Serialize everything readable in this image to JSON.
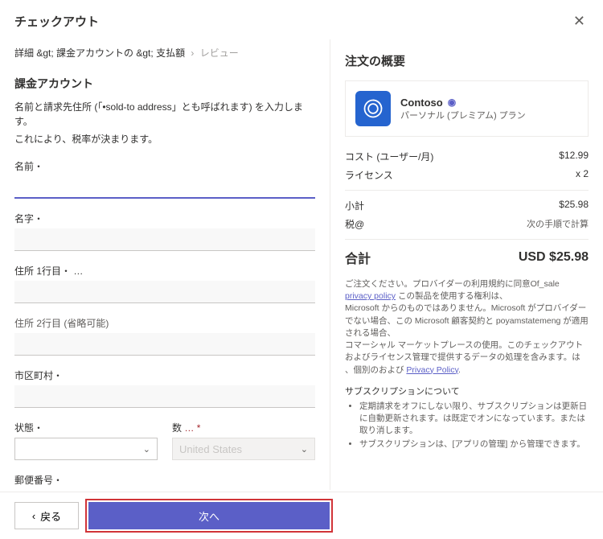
{
  "header": {
    "title": "チェックアウト"
  },
  "breadcrumb": {
    "step1": "詳細 &gt;",
    "step2": "課金アカウントの &gt;",
    "step3": "支払額",
    "step4": "レビュー"
  },
  "form": {
    "section_title": "課金アカウント",
    "help1": "名前と請求先住所 (「•sold-to address」とも呼ばれます) を入力します。",
    "help2": "これにより、税率が決まります。",
    "labels": {
      "first_name": "名前",
      "last_name": "名字",
      "address1": "住所 1行目",
      "address2": "住所 2行目 (省略可能)",
      "city": "市区町村",
      "state": "状態",
      "country": "数",
      "postal": "郵便番号"
    },
    "country_placeholder": "United States"
  },
  "footer": {
    "back": "戻る",
    "next": "次へ"
  },
  "summary": {
    "title": "注文の概要",
    "product_name": "Contoso",
    "product_sub": "パーソナル (プレミアム) プラン",
    "cost_label": "コスト (ユーザー/月)",
    "cost_value": "$12.99",
    "license_label": "ライセンス",
    "license_value": "x 2",
    "subtotal_label": "小計",
    "subtotal_value": "$25.98",
    "tax_label": "税@",
    "tax_value": "次の手順で計算",
    "total_label": "合計",
    "total_value": "USD $25.98"
  },
  "legal": {
    "line1": "ご注文ください。プロバイダーの利用規約に同意Of_sale",
    "link1": "privacy policy",
    "line1b": " この製品を使用する権利は、",
    "line2": "Microsoft からのものではありません。Microsoft がプロバイダーでない場合、この Microsoft 顧客契約と poyamstatemeng が適用される場合、",
    "line3": "コマーシャル マーケットプレースの使用。このチェックアウト",
    "line4": "およびライセンス管理で提供するデータの処理を含みます。は",
    "line5a": "、個別のおよび",
    "link2": "Privacy Policy",
    "line5b": "."
  },
  "subscription": {
    "heading": "サブスクリプションについて",
    "bullet1": "定期請求をオフにしない限り、サブスクリプションは更新日に自動更新されます。は既定でオンになっています。または 取り消します。",
    "bullet2": "サブスクリプションは、[アプリの管理] から管理できます。"
  }
}
